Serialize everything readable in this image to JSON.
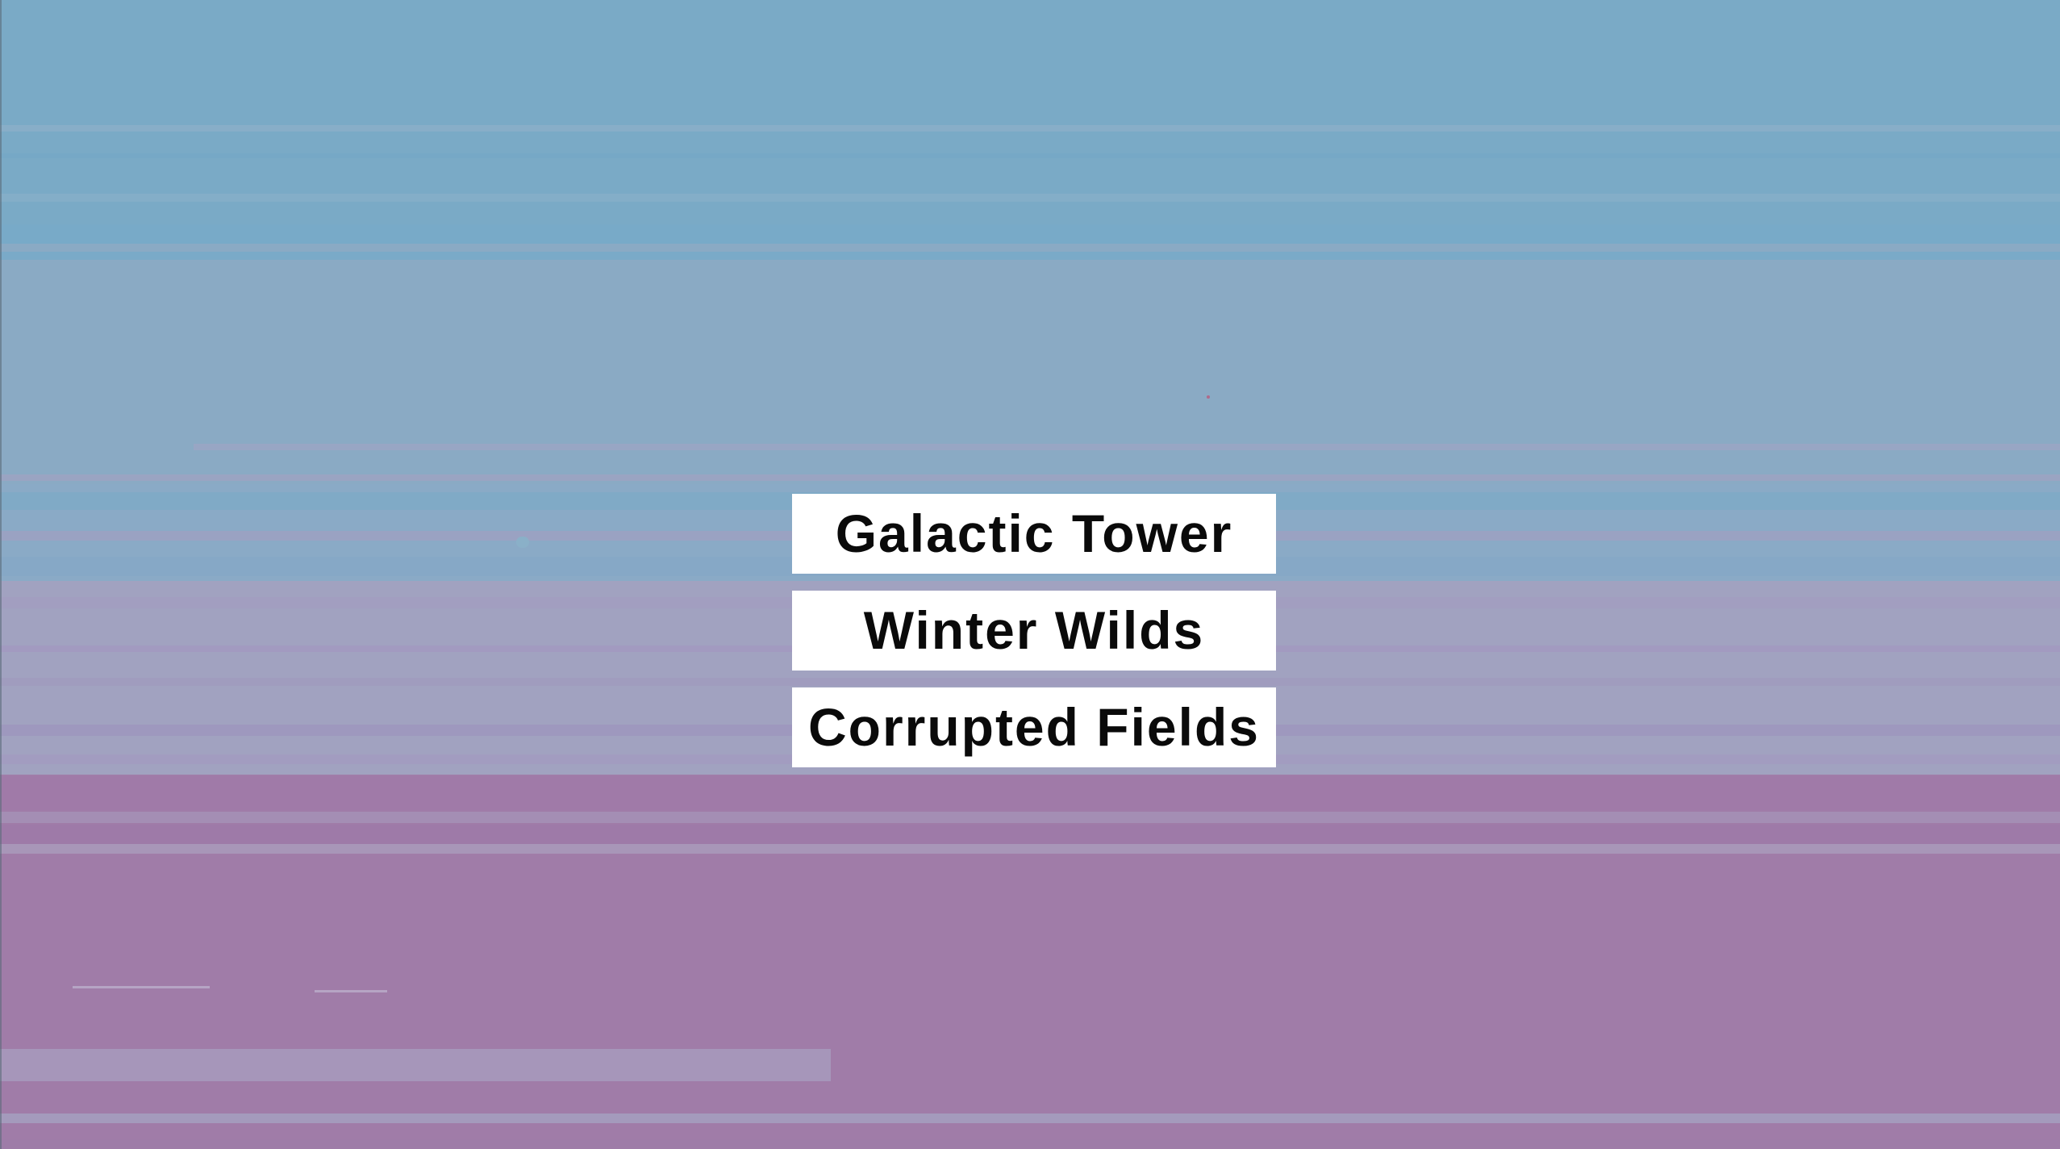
{
  "menu": {
    "levels": [
      {
        "label": "Galactic Tower"
      },
      {
        "label": "Winter Wilds"
      },
      {
        "label": "Corrupted Fields"
      }
    ]
  },
  "colors": {
    "sky_top": "#7aaac6",
    "sky_mid": "#8aaac4",
    "sky_lavender": "#a1a2c0",
    "ground": "#a07ca8",
    "button_bg": "#ffffff",
    "button_text": "#0a0a0a"
  }
}
